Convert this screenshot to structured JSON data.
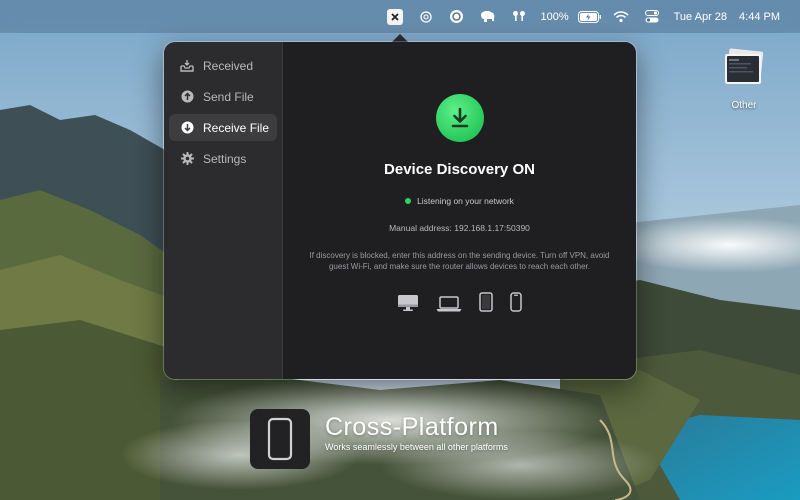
{
  "menubar": {
    "battery": "100%",
    "date": "Tue Apr 28",
    "time": "4:44 PM",
    "icons": [
      "app-status-icon",
      "chatgpt-icon",
      "target-icon",
      "elephant-icon",
      "airpods-icon",
      "battery-icon",
      "wifi-icon",
      "control-center-icon"
    ]
  },
  "sidebar": {
    "items": [
      {
        "label": "Received",
        "icon": "inbox-tray-icon",
        "active": false
      },
      {
        "label": "Send File",
        "icon": "arrow-up-circle-icon",
        "active": false
      },
      {
        "label": "Receive File",
        "icon": "arrow-down-circle-icon",
        "active": true
      },
      {
        "label": "Settings",
        "icon": "gear-icon",
        "active": false
      }
    ]
  },
  "main": {
    "title": "Device Discovery ON",
    "status": "Listening on your network",
    "address": "Manual address: 192.168.1.17:50390",
    "help": "If discovery is blocked, enter this address on the sending device. Turn off VPN, avoid guest Wi-Fi, and make sure the router allows devices to reach each other.",
    "devices": [
      "desktop-icon",
      "laptop-icon",
      "tablet-icon",
      "phone-icon"
    ]
  },
  "desktop": {
    "icon_label": "Other"
  },
  "promo": {
    "title": "Cross-Platform",
    "subtitle": "Works seamlessly between all other platforms"
  },
  "colors": {
    "accent_green": "#35d15a",
    "popover_sidebar": "#2c2c2e",
    "popover_main": "#1f1f21"
  }
}
